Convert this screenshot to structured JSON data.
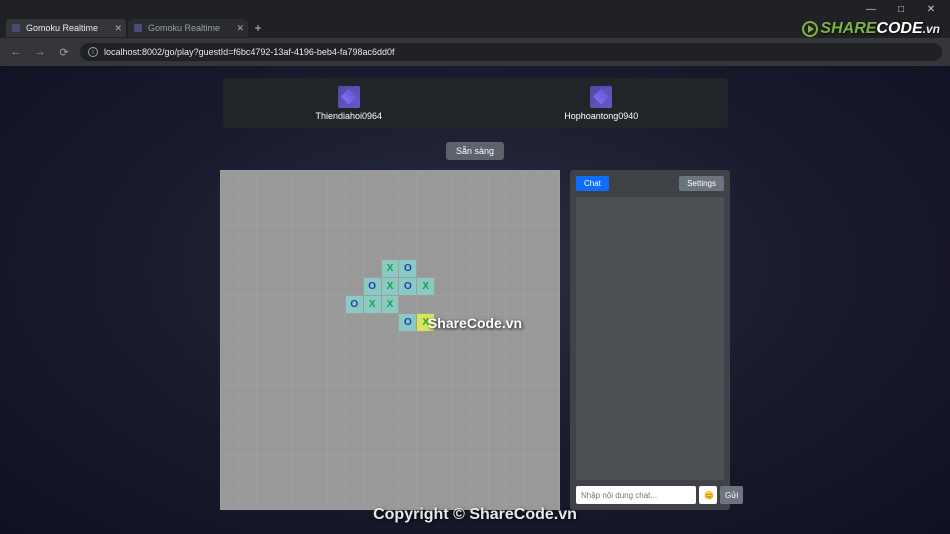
{
  "window": {
    "minimize": "—",
    "maximize": "□",
    "close": "✕"
  },
  "tabs": [
    {
      "title": "Gomoku Realtime",
      "active": true
    },
    {
      "title": "Gomoku Realtime",
      "active": false
    }
  ],
  "url": "localhost:8002/go/play?guestId=f6bc4792-13af-4196-beb4-fa798ac6dd0f",
  "players": {
    "left": {
      "name": "Thiendiahoi0964"
    },
    "right": {
      "name": "Hophoantong0940"
    }
  },
  "ready_button": "Sẵn sàng",
  "board": {
    "size": 19,
    "stones": [
      {
        "r": 5,
        "c": 9,
        "v": "X"
      },
      {
        "r": 5,
        "c": 10,
        "v": "O"
      },
      {
        "r": 6,
        "c": 8,
        "v": "O"
      },
      {
        "r": 6,
        "c": 9,
        "v": "X"
      },
      {
        "r": 6,
        "c": 10,
        "v": "O"
      },
      {
        "r": 6,
        "c": 11,
        "v": "X"
      },
      {
        "r": 7,
        "c": 7,
        "v": "O"
      },
      {
        "r": 7,
        "c": 8,
        "v": "X"
      },
      {
        "r": 7,
        "c": 9,
        "v": "X"
      },
      {
        "r": 8,
        "c": 10,
        "v": "O"
      },
      {
        "r": 8,
        "c": 11,
        "v": "X",
        "last": true
      }
    ]
  },
  "side": {
    "chat_tab": "Chat",
    "settings_tab": "Settings",
    "input_placeholder": "Nhập nội dung chat...",
    "emoji": "😊",
    "send": "Gửi"
  },
  "watermarks": {
    "logo_share": "SHARE",
    "logo_code": "CODE",
    "logo_vn": ".vn",
    "center": "ShareCode.vn",
    "copyright": "Copyright © ShareCode.vn"
  }
}
